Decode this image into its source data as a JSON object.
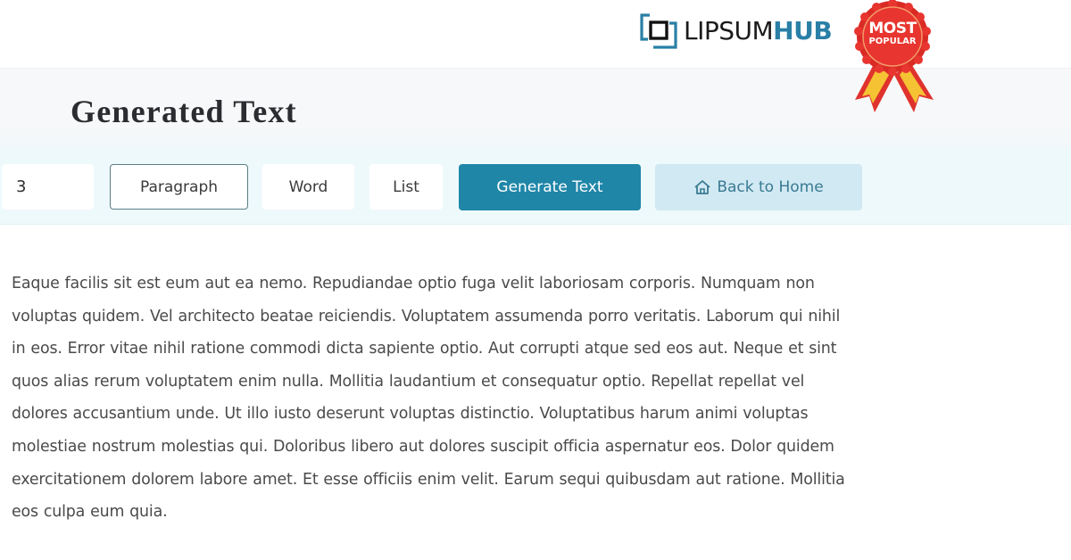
{
  "brand": {
    "name_part1": "LIPSUM",
    "name_part2": "HUB",
    "logo_icon": "stacked-squares-icon",
    "accent_color": "#2a7fa6"
  },
  "badge": {
    "line1": "MOST",
    "line2": "POPULAR",
    "icon": "award-ribbon-icon",
    "color": "#e0322d"
  },
  "header": {
    "title": "Generated Text"
  },
  "toolbar": {
    "count_value": "3",
    "options": [
      {
        "label": "Paragraph",
        "selected": true
      },
      {
        "label": "Word",
        "selected": false
      },
      {
        "label": "List",
        "selected": false
      }
    ],
    "generate_label": "Generate Text",
    "generate_color": "#1f86a8",
    "home_label": "Back to Home",
    "home_icon": "home-icon"
  },
  "content": {
    "lines": [
      "Eaque facilis sit est eum aut ea nemo. Repudiandae optio fuga velit laboriosam corporis. Numquam non",
      "voluptas quidem. Vel architecto beatae reiciendis. Voluptatem assumenda porro veritatis. Laborum qui nihil",
      "in eos. Error vitae nihil ratione commodi dicta sapiente optio. Aut corrupti atque sed eos aut. Neque et sint",
      "quos alias rerum voluptatem enim nulla. Mollitia laudantium et consequatur optio. Repellat repellat vel",
      "dolores accusantium unde. Ut illo iusto deserunt voluptas distinctio. Voluptatibus harum animi voluptas",
      "molestiae nostrum molestias qui. Doloribus libero aut dolores suscipit officia aspernatur eos. Dolor quidem",
      "exercitationem dolorem labore amet. Et esse officiis enim velit. Earum sequi quibusdam aut ratione. Mollitia",
      "eos culpa eum quia."
    ]
  }
}
